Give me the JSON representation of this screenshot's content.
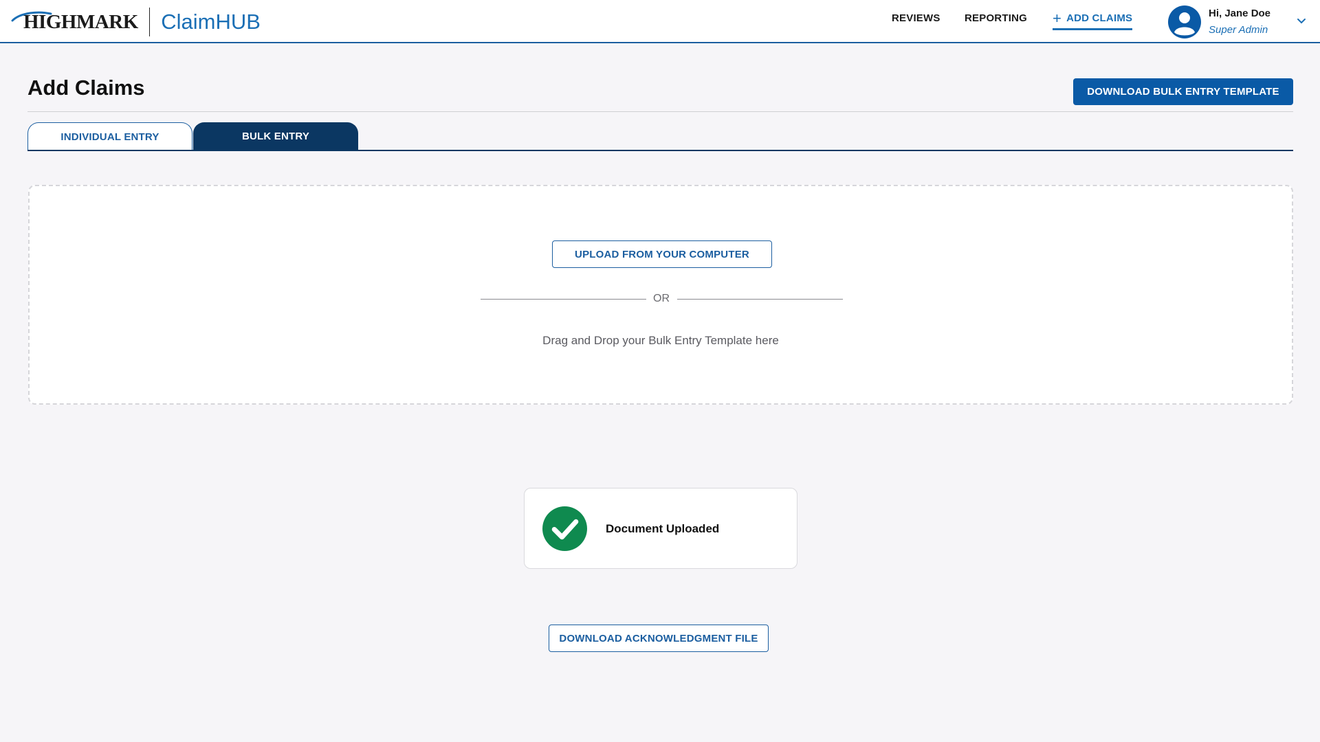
{
  "header": {
    "brand": "HIGHMARK",
    "app_name": "ClaimHUB",
    "nav": {
      "reviews": "REVIEWS",
      "reporting": "REPORTING",
      "add_claims": "ADD CLAIMS"
    },
    "user": {
      "greeting": "Hi, Jane Doe",
      "role": "Super Admin"
    },
    "icons": {
      "add": "plus-icon",
      "avatar": "user-avatar-icon",
      "menu": "chevron-down-icon"
    }
  },
  "page": {
    "title": "Add Claims",
    "download_template_label": "DOWNLOAD BULK ENTRY TEMPLATE"
  },
  "tabs": [
    {
      "label": "INDIVIDUAL ENTRY",
      "active": false
    },
    {
      "label": "BULK ENTRY",
      "active": true
    }
  ],
  "dropzone": {
    "upload_label": "UPLOAD FROM YOUR COMPUTER",
    "or_text": "OR",
    "drag_text": "Drag and Drop your Bulk Entry Template here"
  },
  "status": {
    "text": "Document Uploaded",
    "icon": "check-circle-icon"
  },
  "download_ack_label": "DOWNLOAD ACKNOWLEDGMENT FILE",
  "colors": {
    "brand_blue": "#1b6fb5",
    "primary_button": "#0a5aa6",
    "active_tab": "#0b3762",
    "success_green": "#0f8a4f",
    "background": "#f6f5f8"
  }
}
